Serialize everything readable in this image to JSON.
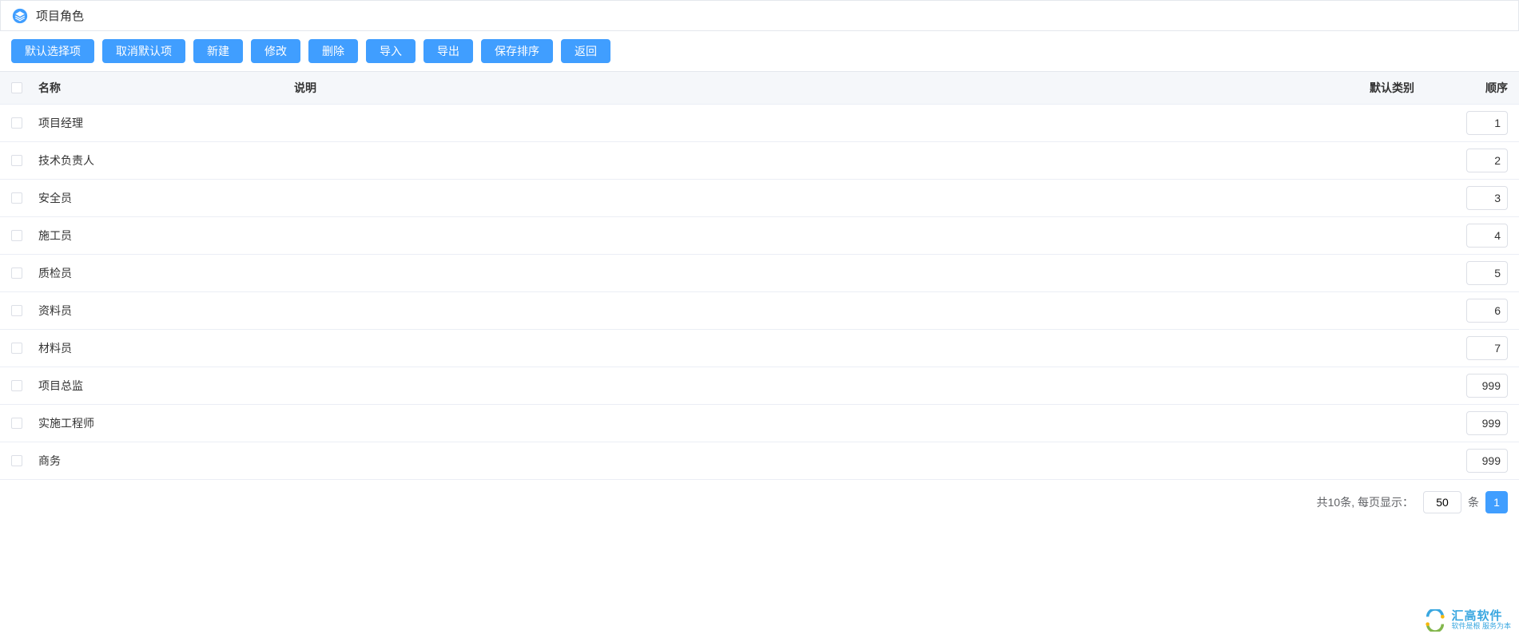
{
  "header": {
    "title": "项目角色"
  },
  "toolbar": {
    "buttons": [
      {
        "name": "default-select-button",
        "label": "默认选择项"
      },
      {
        "name": "cancel-default-button",
        "label": "取消默认项"
      },
      {
        "name": "new-button",
        "label": "新建"
      },
      {
        "name": "edit-button",
        "label": "修改"
      },
      {
        "name": "delete-button",
        "label": "删除"
      },
      {
        "name": "import-button",
        "label": "导入"
      },
      {
        "name": "export-button",
        "label": "导出"
      },
      {
        "name": "save-sort-button",
        "label": "保存排序"
      },
      {
        "name": "back-button",
        "label": "返回"
      }
    ]
  },
  "table": {
    "columns": {
      "name": "名称",
      "desc": "说明",
      "default": "默认类别",
      "order": "顺序"
    },
    "rows": [
      {
        "name": "项目经理",
        "desc": "",
        "default": "",
        "order": "1"
      },
      {
        "name": "技术负责人",
        "desc": "",
        "default": "",
        "order": "2"
      },
      {
        "name": "安全员",
        "desc": "",
        "default": "",
        "order": "3"
      },
      {
        "name": "施工员",
        "desc": "",
        "default": "",
        "order": "4"
      },
      {
        "name": "质检员",
        "desc": "",
        "default": "",
        "order": "5"
      },
      {
        "name": "资料员",
        "desc": "",
        "default": "",
        "order": "6"
      },
      {
        "name": "材料员",
        "desc": "",
        "default": "",
        "order": "7"
      },
      {
        "name": "项目总监",
        "desc": "",
        "default": "",
        "order": "999"
      },
      {
        "name": "实施工程师",
        "desc": "",
        "default": "",
        "order": "999"
      },
      {
        "name": "商务",
        "desc": "",
        "default": "",
        "order": "999"
      }
    ]
  },
  "pagination": {
    "total_text": "共10条, 每页显示：",
    "page_size": "50",
    "unit": "条",
    "current_page": "1"
  },
  "watermark": {
    "main": "汇高软件",
    "sub": "软件是根 服务为本"
  }
}
